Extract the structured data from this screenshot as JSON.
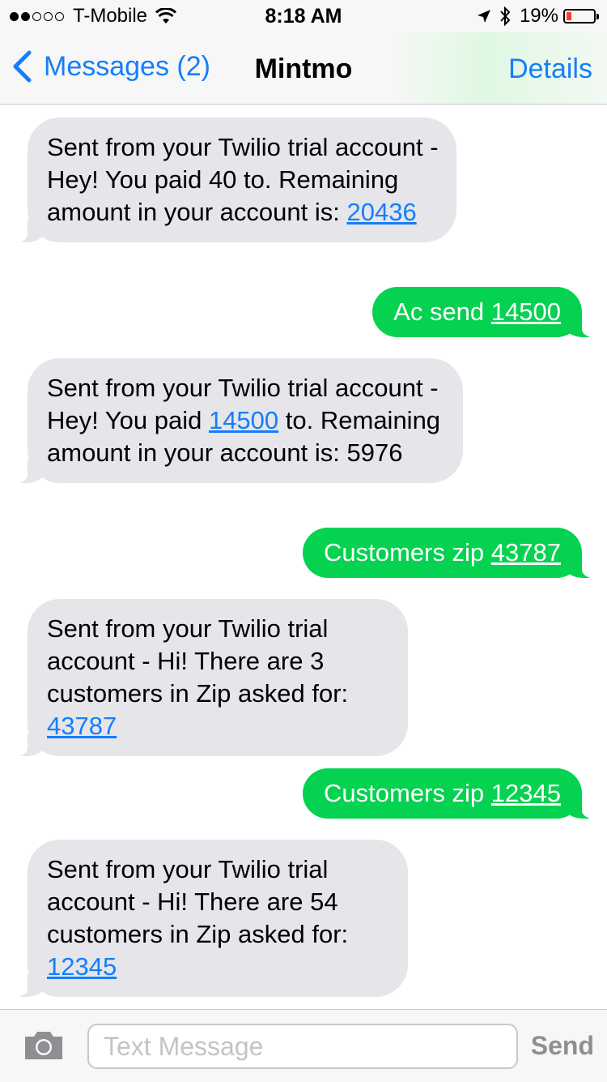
{
  "status_bar": {
    "carrier": "T-Mobile",
    "time": "8:18 AM",
    "battery_percent": "19%",
    "battery_level": 0.19,
    "battery_color": "#ff3b30",
    "icons": [
      "signal-dots",
      "wifi-icon",
      "location-arrow-icon",
      "bluetooth-icon",
      "battery-icon"
    ]
  },
  "nav": {
    "back_label": "Messages (2)",
    "title": "Mintmo",
    "details_label": "Details"
  },
  "messages": [
    {
      "direction": "incoming",
      "text_before": "Sent from your Twilio trial account - Hey!  You paid 40 to. Remaining amount in your account is: ",
      "link": "20436",
      "text_after": ""
    },
    {
      "direction": "outgoing",
      "text_before": "Ac send ",
      "link": "14500",
      "text_after": ""
    },
    {
      "direction": "incoming",
      "text_before": "Sent from your Twilio trial account - Hey!  You paid ",
      "link": "14500",
      "text_after": " to. Remaining amount in your account is: 5976"
    },
    {
      "direction": "outgoing",
      "text_before": "Customers zip ",
      "link": "43787",
      "text_after": ""
    },
    {
      "direction": "incoming",
      "text_before": "Sent from your Twilio trial account - Hi! There are 3 customers in Zip asked for: ",
      "link": "43787",
      "text_after": ""
    },
    {
      "direction": "outgoing",
      "text_before": "Customers zip ",
      "link": "12345",
      "text_after": ""
    },
    {
      "direction": "incoming",
      "text_before": "Sent from your Twilio trial account - Hi! There are 54 customers in Zip asked for: ",
      "link": "12345",
      "text_after": ""
    }
  ],
  "input": {
    "placeholder": "Text Message",
    "value": "",
    "send_label": "Send"
  },
  "colors": {
    "accent": "#147efb",
    "outgoing_bubble": "#05d250",
    "incoming_bubble": "#e5e5ea"
  }
}
